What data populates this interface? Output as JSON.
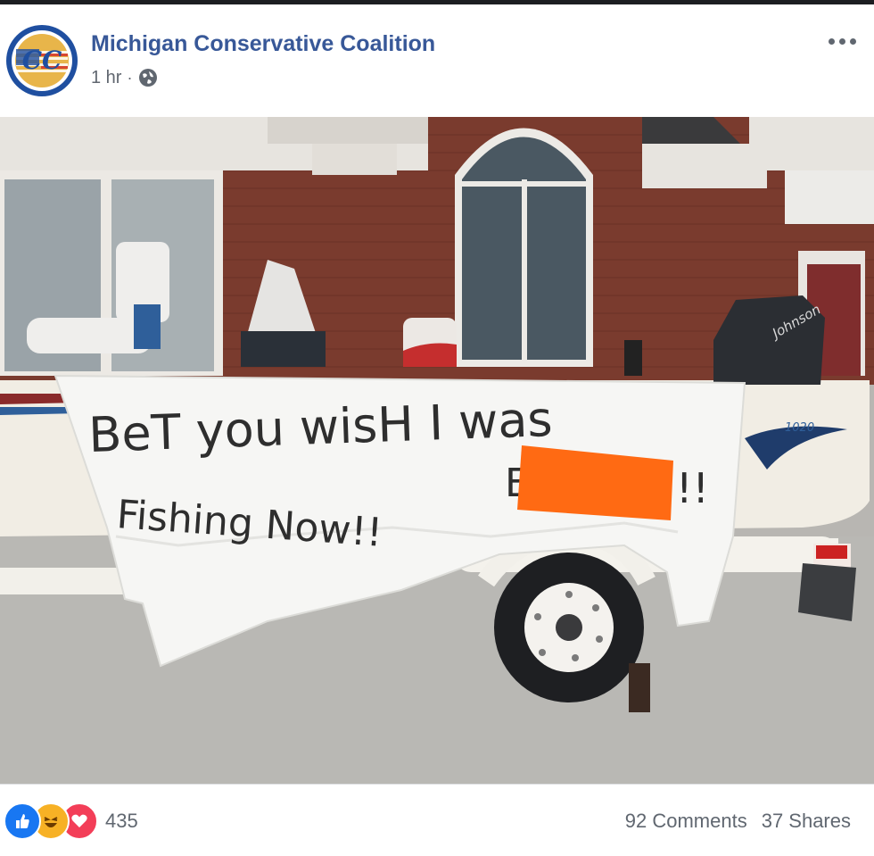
{
  "post": {
    "page_name": "Michigan Conservative Coalition",
    "timestamp": "1 hr",
    "separator": "·",
    "privacy_icon": "globe-icon",
    "avatar_text": "CC",
    "avatar_ring_text": "MICHIGAN CONSERVATIVE COALITION",
    "more_icon": "ellipsis-icon"
  },
  "photo": {
    "sign_line_1": "BeT you wisH I was",
    "sign_line_2": "Fishing Now!!",
    "sign_end_mark": "!!",
    "sign_redacted_letter": "E",
    "motor_brand": "Johnson",
    "boat_badge": "1020"
  },
  "footer": {
    "reaction_icons": [
      "like-icon",
      "haha-icon",
      "love-icon"
    ],
    "reaction_count": "435",
    "comments": "92 Comments",
    "shares": "37 Shares"
  },
  "colors": {
    "link_blue": "#385898",
    "meta_gray": "#616770",
    "brick": "#7a3b2e",
    "redaction_orange": "#ff6a13",
    "like_blue": "#1877f2",
    "love_red": "#f33e58",
    "haha_yellow": "#f7b125"
  }
}
